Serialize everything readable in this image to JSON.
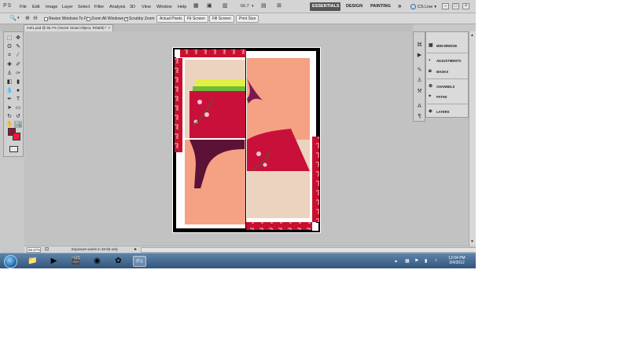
{
  "menubar": {
    "logo": "PS",
    "items": [
      "File",
      "Edit",
      "Image",
      "Layer",
      "Select",
      "Filter",
      "Analysis",
      "3D",
      "View",
      "Window",
      "Help"
    ],
    "zoom": "66.7",
    "workspaces": {
      "essentials": "ESSENTIALS",
      "design": "DESIGN",
      "painting": "PAINTING",
      "more": "»"
    },
    "cslive": "CS Live",
    "window_buttons": [
      "–",
      "□",
      "×"
    ]
  },
  "options": {
    "resize_windows": "Resize Windows To Fit",
    "zoom_all_windows": "Zoom All Windows",
    "scrubby_zoom": "Scrubby Zoom",
    "actual_pixels": "Actual Pixels",
    "fit_screen": "Fit Screen",
    "fill_screen": "Fill Screen",
    "print_size": "Print Size"
  },
  "document_tab": {
    "title": "mel1.psd @ 66.7% (Vector Smart Object, RGB/8) *",
    "close": "×"
  },
  "panels": {
    "items": [
      "MINI BRIDGE",
      "ADJUSTMENTS",
      "MASKS",
      "CHANNELS",
      "PATHS",
      "LAYERS"
    ]
  },
  "statusbar": {
    "zoom": "66.67%",
    "message": "Exposure works in 32-bit only"
  },
  "colors": {
    "foreground": "#9a0e3c",
    "background": "#ee1a3a",
    "art_red": "#d41e3f",
    "art_salmon": "#f5a183",
    "art_beige": "#ecd3bf"
  },
  "taskbar": {
    "clock_time": "12:04 PM",
    "clock_date": "2/4/2012"
  }
}
